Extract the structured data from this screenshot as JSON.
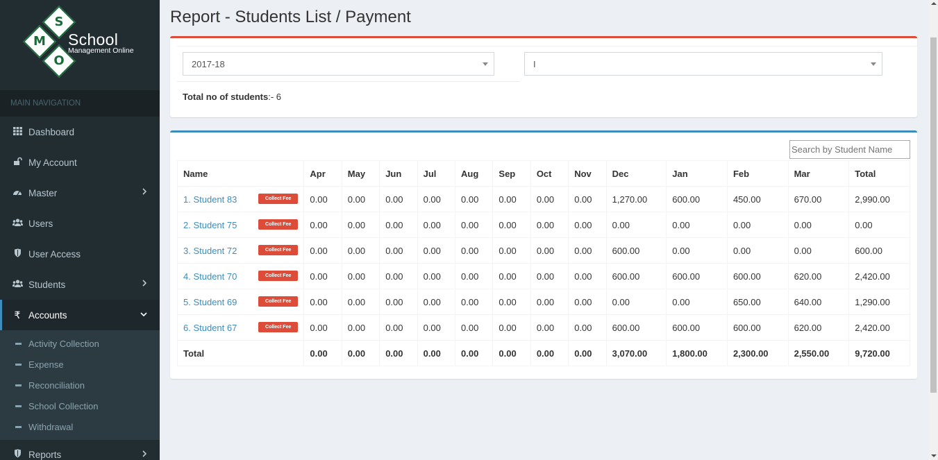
{
  "logo": {
    "title": "School",
    "subtitle": "Management Online",
    "letters": [
      "S",
      "M",
      "O"
    ]
  },
  "sidebar": {
    "header": "MAIN NAVIGATION",
    "items": [
      {
        "label": "Dashboard",
        "icon": "grid-icon"
      },
      {
        "label": "My Account",
        "icon": "unlock-icon"
      },
      {
        "label": "Master",
        "icon": "dashboard-icon"
      },
      {
        "label": "Users",
        "icon": "users-icon"
      },
      {
        "label": "User Access",
        "icon": "shield-icon"
      },
      {
        "label": "Students",
        "icon": "users-icon"
      },
      {
        "label": "Accounts",
        "icon": "rupee-icon"
      }
    ],
    "accounts_submenu": [
      "Activity Collection",
      "Expense",
      "Reconciliation",
      "School Collection",
      "Withdrawal"
    ],
    "reports": {
      "label": "Reports",
      "icon": "shield-icon"
    }
  },
  "page": {
    "title": "Report - Students List / Payment"
  },
  "filters": {
    "year": "2017-18",
    "class": "I",
    "total_label": "Total no of students",
    "total_value": ":- 6"
  },
  "search": {
    "placeholder": "Search by Student Name"
  },
  "table": {
    "headers": [
      "Name",
      "Apr",
      "May",
      "Jun",
      "Jul",
      "Aug",
      "Sep",
      "Oct",
      "Nov",
      "Dec",
      "Jan",
      "Feb",
      "Mar",
      "Total"
    ],
    "collect_label": "Collect Fee",
    "rows": [
      {
        "name": "1. Student 83",
        "months": [
          "0.00",
          "0.00",
          "0.00",
          "0.00",
          "0.00",
          "0.00",
          "0.00",
          "0.00",
          "1,270.00",
          "600.00",
          "450.00",
          "670.00"
        ],
        "total": "2,990.00"
      },
      {
        "name": "2. Student 75",
        "months": [
          "0.00",
          "0.00",
          "0.00",
          "0.00",
          "0.00",
          "0.00",
          "0.00",
          "0.00",
          "0.00",
          "0.00",
          "0.00",
          "0.00"
        ],
        "total": "0.00"
      },
      {
        "name": "3. Student 72",
        "months": [
          "0.00",
          "0.00",
          "0.00",
          "0.00",
          "0.00",
          "0.00",
          "0.00",
          "0.00",
          "600.00",
          "0.00",
          "0.00",
          "0.00"
        ],
        "total": "600.00"
      },
      {
        "name": "4. Student 70",
        "months": [
          "0.00",
          "0.00",
          "0.00",
          "0.00",
          "0.00",
          "0.00",
          "0.00",
          "0.00",
          "600.00",
          "600.00",
          "600.00",
          "620.00"
        ],
        "total": "2,420.00"
      },
      {
        "name": "5. Student 69",
        "months": [
          "0.00",
          "0.00",
          "0.00",
          "0.00",
          "0.00",
          "0.00",
          "0.00",
          "0.00",
          "0.00",
          "0.00",
          "650.00",
          "640.00"
        ],
        "total": "1,290.00"
      },
      {
        "name": "6. Student 67",
        "months": [
          "0.00",
          "0.00",
          "0.00",
          "0.00",
          "0.00",
          "0.00",
          "0.00",
          "0.00",
          "600.00",
          "600.00",
          "600.00",
          "620.00"
        ],
        "total": "2,420.00"
      }
    ],
    "footer": {
      "label": "Total",
      "months": [
        "0.00",
        "0.00",
        "0.00",
        "0.00",
        "0.00",
        "0.00",
        "0.00",
        "0.00",
        "3,070.00",
        "1,800.00",
        "2,300.00",
        "2,550.00"
      ],
      "total": "9,720.00"
    }
  },
  "colors": {
    "sidebar": "#222d32",
    "accent_blue": "#3c8dbc",
    "accent_red": "#dd4b39",
    "link": "#3c8dbc"
  }
}
